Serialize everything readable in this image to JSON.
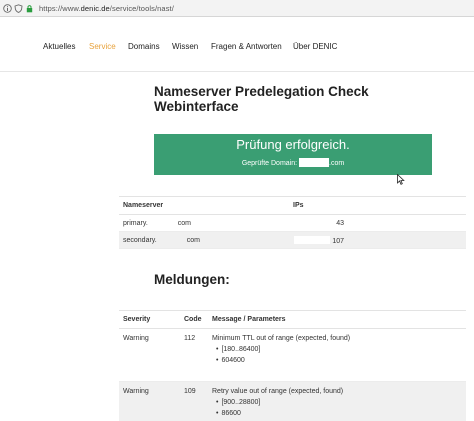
{
  "browser": {
    "url_prefix": "https://www.",
    "url_domain": "denic.de",
    "url_path": "/service/tools/nast/"
  },
  "nav": {
    "items": [
      "Aktuelles",
      "Service",
      "Domains",
      "Wissen",
      "Fragen & Antworten",
      "Über DENIC"
    ],
    "active": "Service"
  },
  "page": {
    "title_line1": "Nameserver Predelegation Check",
    "title_line2": "Webinterface"
  },
  "result": {
    "headline": "Prüfung erfolgreich.",
    "checked_label": "Geprüfte Domain:",
    "checked_suffix": ".com",
    "color": "#3a9e73"
  },
  "nameservers": {
    "headers": [
      "Nameserver",
      "IPs"
    ],
    "rows": [
      {
        "prefix": "primary.",
        "suffix": "com",
        "ip": "43"
      },
      {
        "prefix": "secondary.",
        "suffix": "com",
        "ip": "107"
      }
    ]
  },
  "messages": {
    "heading": "Meldungen:",
    "headers": [
      "Severity",
      "Code",
      "Message / Parameters"
    ],
    "rows": [
      {
        "severity": "Warning",
        "code": "112",
        "message": "Minimum TTL out of range (expected, found)",
        "params": [
          "[180..86400]",
          "604600"
        ]
      },
      {
        "severity": "Warning",
        "code": "109",
        "message": "Retry value out of range (expected, found)",
        "params": [
          "[900..28800]",
          "86600"
        ]
      }
    ]
  },
  "icons": [
    "info-icon",
    "shield-icon",
    "lock-icon",
    "mouse-cursor-icon"
  ]
}
